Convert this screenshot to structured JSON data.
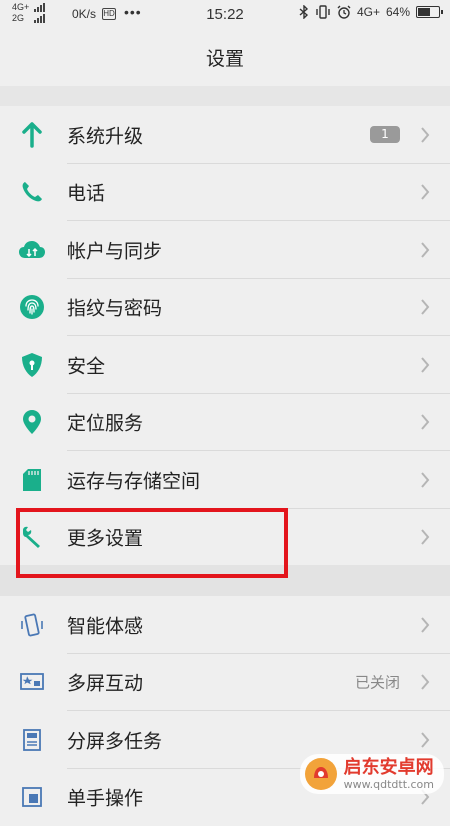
{
  "status_bar": {
    "net1": "4G+",
    "net2": "2G",
    "speed": "0K/s",
    "hd_icon": "HD",
    "dots": "•••",
    "time": "15:22",
    "right_net": "4G+",
    "battery_text": "64%",
    "battery_level": 0.64
  },
  "header": {
    "title": "设置"
  },
  "group1": {
    "items": [
      {
        "label": "系统升级",
        "icon": "arrow-up-icon",
        "badge": "1"
      },
      {
        "label": "电话",
        "icon": "phone-icon"
      },
      {
        "label": "帐户与同步",
        "icon": "cloud-sync-icon"
      },
      {
        "label": "指纹与密码",
        "icon": "fingerprint-icon"
      },
      {
        "label": "安全",
        "icon": "shield-icon"
      },
      {
        "label": "定位服务",
        "icon": "location-pin-icon"
      },
      {
        "label": "运存与存储空间",
        "icon": "sd-card-icon"
      },
      {
        "label": "更多设置",
        "icon": "wrench-icon"
      }
    ]
  },
  "group2": {
    "items": [
      {
        "label": "智能体感",
        "icon": "phone-motion-icon"
      },
      {
        "label": "多屏互动",
        "icon": "screen-cast-icon",
        "status": "已关闭"
      },
      {
        "label": "分屏多任务",
        "icon": "split-screen-icon"
      },
      {
        "label": "单手操作",
        "icon": "one-hand-icon"
      }
    ]
  },
  "watermark": {
    "title": "启东安卓网",
    "url": "www.qdtdtt.com"
  },
  "colors": {
    "accent": "#1aaf8b",
    "blue_icon": "#4a78b5",
    "highlight": "#e3151c"
  }
}
